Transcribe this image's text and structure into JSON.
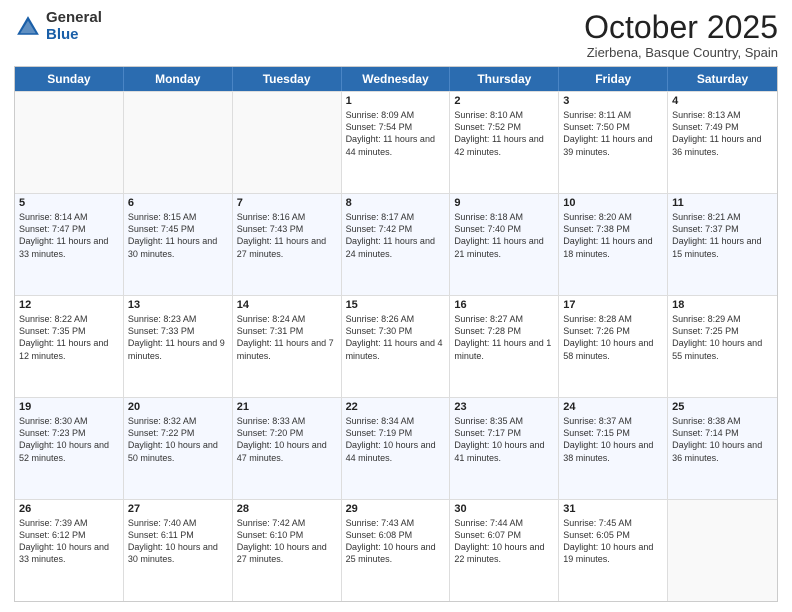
{
  "logo": {
    "general": "General",
    "blue": "Blue"
  },
  "header": {
    "month": "October 2025",
    "location": "Zierbena, Basque Country, Spain"
  },
  "weekdays": [
    "Sunday",
    "Monday",
    "Tuesday",
    "Wednesday",
    "Thursday",
    "Friday",
    "Saturday"
  ],
  "weeks": [
    [
      {
        "day": "",
        "empty": true
      },
      {
        "day": "",
        "empty": true
      },
      {
        "day": "",
        "empty": true
      },
      {
        "day": "1",
        "sunrise": "8:09 AM",
        "sunset": "7:54 PM",
        "daylight": "11 hours and 44 minutes."
      },
      {
        "day": "2",
        "sunrise": "8:10 AM",
        "sunset": "7:52 PM",
        "daylight": "11 hours and 42 minutes."
      },
      {
        "day": "3",
        "sunrise": "8:11 AM",
        "sunset": "7:50 PM",
        "daylight": "11 hours and 39 minutes."
      },
      {
        "day": "4",
        "sunrise": "8:13 AM",
        "sunset": "7:49 PM",
        "daylight": "11 hours and 36 minutes."
      }
    ],
    [
      {
        "day": "5",
        "sunrise": "8:14 AM",
        "sunset": "7:47 PM",
        "daylight": "11 hours and 33 minutes."
      },
      {
        "day": "6",
        "sunrise": "8:15 AM",
        "sunset": "7:45 PM",
        "daylight": "11 hours and 30 minutes."
      },
      {
        "day": "7",
        "sunrise": "8:16 AM",
        "sunset": "7:43 PM",
        "daylight": "11 hours and 27 minutes."
      },
      {
        "day": "8",
        "sunrise": "8:17 AM",
        "sunset": "7:42 PM",
        "daylight": "11 hours and 24 minutes."
      },
      {
        "day": "9",
        "sunrise": "8:18 AM",
        "sunset": "7:40 PM",
        "daylight": "11 hours and 21 minutes."
      },
      {
        "day": "10",
        "sunrise": "8:20 AM",
        "sunset": "7:38 PM",
        "daylight": "11 hours and 18 minutes."
      },
      {
        "day": "11",
        "sunrise": "8:21 AM",
        "sunset": "7:37 PM",
        "daylight": "11 hours and 15 minutes."
      }
    ],
    [
      {
        "day": "12",
        "sunrise": "8:22 AM",
        "sunset": "7:35 PM",
        "daylight": "11 hours and 12 minutes."
      },
      {
        "day": "13",
        "sunrise": "8:23 AM",
        "sunset": "7:33 PM",
        "daylight": "11 hours and 9 minutes."
      },
      {
        "day": "14",
        "sunrise": "8:24 AM",
        "sunset": "7:31 PM",
        "daylight": "11 hours and 7 minutes."
      },
      {
        "day": "15",
        "sunrise": "8:26 AM",
        "sunset": "7:30 PM",
        "daylight": "11 hours and 4 minutes."
      },
      {
        "day": "16",
        "sunrise": "8:27 AM",
        "sunset": "7:28 PM",
        "daylight": "11 hours and 1 minute."
      },
      {
        "day": "17",
        "sunrise": "8:28 AM",
        "sunset": "7:26 PM",
        "daylight": "10 hours and 58 minutes."
      },
      {
        "day": "18",
        "sunrise": "8:29 AM",
        "sunset": "7:25 PM",
        "daylight": "10 hours and 55 minutes."
      }
    ],
    [
      {
        "day": "19",
        "sunrise": "8:30 AM",
        "sunset": "7:23 PM",
        "daylight": "10 hours and 52 minutes."
      },
      {
        "day": "20",
        "sunrise": "8:32 AM",
        "sunset": "7:22 PM",
        "daylight": "10 hours and 50 minutes."
      },
      {
        "day": "21",
        "sunrise": "8:33 AM",
        "sunset": "7:20 PM",
        "daylight": "10 hours and 47 minutes."
      },
      {
        "day": "22",
        "sunrise": "8:34 AM",
        "sunset": "7:19 PM",
        "daylight": "10 hours and 44 minutes."
      },
      {
        "day": "23",
        "sunrise": "8:35 AM",
        "sunset": "7:17 PM",
        "daylight": "10 hours and 41 minutes."
      },
      {
        "day": "24",
        "sunrise": "8:37 AM",
        "sunset": "7:15 PM",
        "daylight": "10 hours and 38 minutes."
      },
      {
        "day": "25",
        "sunrise": "8:38 AM",
        "sunset": "7:14 PM",
        "daylight": "10 hours and 36 minutes."
      }
    ],
    [
      {
        "day": "26",
        "sunrise": "7:39 AM",
        "sunset": "6:12 PM",
        "daylight": "10 hours and 33 minutes."
      },
      {
        "day": "27",
        "sunrise": "7:40 AM",
        "sunset": "6:11 PM",
        "daylight": "10 hours and 30 minutes."
      },
      {
        "day": "28",
        "sunrise": "7:42 AM",
        "sunset": "6:10 PM",
        "daylight": "10 hours and 27 minutes."
      },
      {
        "day": "29",
        "sunrise": "7:43 AM",
        "sunset": "6:08 PM",
        "daylight": "10 hours and 25 minutes."
      },
      {
        "day": "30",
        "sunrise": "7:44 AM",
        "sunset": "6:07 PM",
        "daylight": "10 hours and 22 minutes."
      },
      {
        "day": "31",
        "sunrise": "7:45 AM",
        "sunset": "6:05 PM",
        "daylight": "10 hours and 19 minutes."
      },
      {
        "day": "",
        "empty": true
      }
    ]
  ]
}
